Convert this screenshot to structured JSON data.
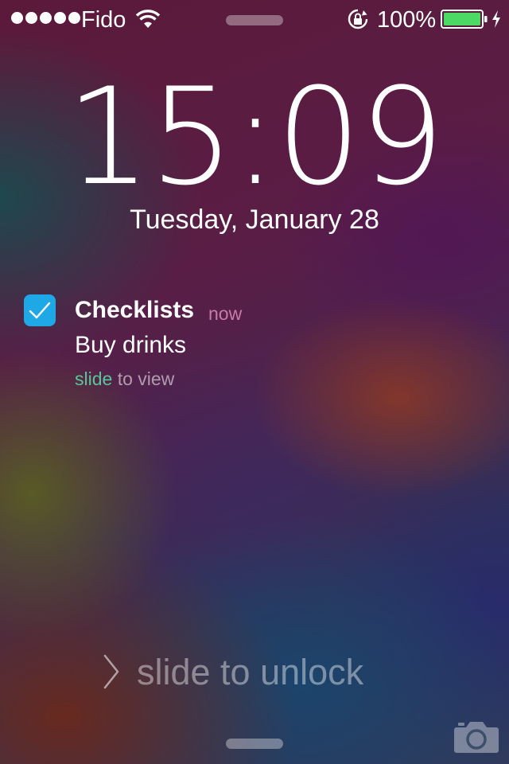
{
  "status_bar": {
    "carrier": "Fido",
    "signal_bars": 5,
    "battery_percent": "100%",
    "battery_level": 1.0,
    "battery_color": "#4cd964",
    "icons": [
      "signal-dots",
      "wifi-icon",
      "rotation-lock-icon",
      "battery-icon",
      "charging-bolt-icon"
    ]
  },
  "lock_screen": {
    "time": "15:09",
    "date": "Tuesday, January 28"
  },
  "notification": {
    "app_name": "Checklists",
    "app_icon": "checkmark-icon",
    "app_icon_color": "#1fa8e6",
    "time": "now",
    "time_color": "#c97aa8",
    "message": "Buy drinks",
    "action_verb": "slide",
    "action_rest": " to view",
    "action_accent_color": "#58c59a"
  },
  "unlock": {
    "label": "slide to unlock",
    "chevron_icon": "chevron-right-icon",
    "camera_icon": "camera-icon"
  }
}
